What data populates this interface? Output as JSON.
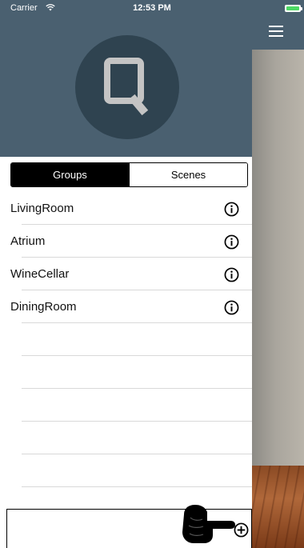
{
  "status_bar": {
    "carrier": "Carrier",
    "time": "12:53 PM",
    "icons": [
      "wifi-icon",
      "battery-icon"
    ]
  },
  "colors": {
    "header_bg": "#4a6070",
    "logo_circle": "#2f4350",
    "logo_letter": "#c4c4c4",
    "battery_green": "#4cd964"
  },
  "segmented": {
    "groups_label": "Groups",
    "scenes_label": "Scenes",
    "selected": "Groups"
  },
  "groups": [
    {
      "name": "LivingRoom"
    },
    {
      "name": "Atrium"
    },
    {
      "name": "WineCellar"
    },
    {
      "name": "DiningRoom"
    }
  ],
  "icons": {
    "menu": "hamburger-menu-icon",
    "row_action": "info-icon",
    "add": "add-circle-icon",
    "hint": "pointing-hand-icon"
  }
}
